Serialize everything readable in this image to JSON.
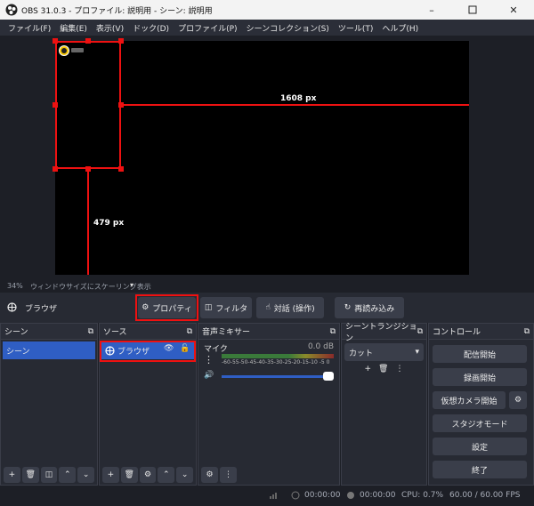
{
  "window": {
    "title": "OBS 31.0.3 - プロファイル: 説明用 - シーン: 説明用"
  },
  "menu": [
    "ファイル(F)",
    "編集(E)",
    "表示(V)",
    "ドック(D)",
    "プロファイル(P)",
    "シーンコレクション(S)",
    "ツール(T)",
    "ヘルプ(H)"
  ],
  "preview": {
    "width_label": "1608 px",
    "height_label": "479 px",
    "scale_percent": "34%",
    "scale_mode": "ウィンドウサイズにスケーリング表示"
  },
  "source_toolbar": {
    "selected_source": "ブラウザ",
    "properties_label": "プロパティ",
    "filters_label": "フィルタ",
    "interact_label": "対話 (操作)",
    "reload_label": "再読み込み"
  },
  "scenes": {
    "title": "シーン",
    "items": [
      "シーン"
    ]
  },
  "sources": {
    "title": "ソース",
    "items": [
      "ブラウザ"
    ]
  },
  "mixer": {
    "title": "音声ミキサー",
    "channel_name": "マイク",
    "db_value": "0.0 dB",
    "scale": "-60-55-50-45-40-35-30-25-20-15-10 -5 0",
    "volume_level": 1.0
  },
  "transitions": {
    "title": "シーントランジション",
    "selected": "カット"
  },
  "controls": {
    "title": "コントロール",
    "buttons": [
      "配信開始",
      "録画開始",
      "仮想カメラ開始",
      "スタジオモード",
      "設定",
      "終了"
    ]
  },
  "status": {
    "stream_time": "00:00:00",
    "record_time": "00:00:00",
    "cpu": "CPU: 0.7%",
    "fps": "60.00 / 60.00 FPS"
  },
  "colors": {
    "accent_blue": "#2f5ec4",
    "highlight_red": "#e11111"
  }
}
